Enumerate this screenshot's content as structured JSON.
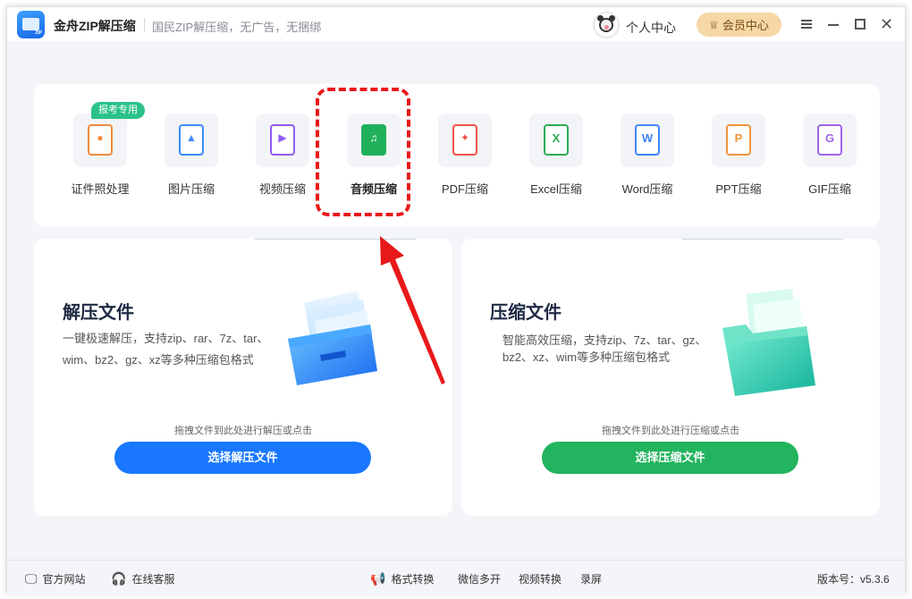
{
  "app": {
    "title": "金舟ZIP解压缩",
    "slogan": "国民ZIP解压缩，无广告，无捆绑",
    "logo_tag": "ZIP"
  },
  "header": {
    "personal_center": "个人中心",
    "vip_center": "会员中心"
  },
  "tools": [
    {
      "label": "证件照处理",
      "icon": "id-photo-icon",
      "color": "#f08a3c",
      "letter": "",
      "badge": "报考专用"
    },
    {
      "label": "图片压缩",
      "icon": "image-icon",
      "color": "#3d8af7",
      "letter": ""
    },
    {
      "label": "视频压缩",
      "icon": "video-icon",
      "color": "#8f5bf0",
      "letter": ""
    },
    {
      "label": "音频压缩",
      "icon": "audio-icon",
      "color": "#1fb05a",
      "letter": ""
    },
    {
      "label": "PDF压缩",
      "icon": "pdf-icon",
      "color": "#f0524a",
      "letter": ""
    },
    {
      "label": "Excel压缩",
      "icon": "excel-icon",
      "color": "#2aab58",
      "letter": "X"
    },
    {
      "label": "Word压缩",
      "icon": "word-icon",
      "color": "#3f86f5",
      "letter": "W"
    },
    {
      "label": "PPT压缩",
      "icon": "ppt-icon",
      "color": "#f0953a",
      "letter": "P"
    },
    {
      "label": "GIF压缩",
      "icon": "gif-icon",
      "color": "#a064e6",
      "letter": "G"
    }
  ],
  "decompress": {
    "title": "解压文件",
    "desc": "一键极速解压，支持zip、rar、7z、tar、wim、bz2、gz、xz等多种压缩包格式",
    "hint": "拖拽文件到此处进行解压或点击",
    "button": "选择解压文件",
    "color": "#1978ff"
  },
  "compress": {
    "title": "压缩文件",
    "desc": "智能高效压缩，支持zip、7z、tar、gz、bz2、xz、wim等多种压缩包格式",
    "hint": "拖拽文件到此处进行压缩或点击",
    "button": "选择压缩文件",
    "color": "#22b45e"
  },
  "footer": {
    "website": "官方网站",
    "support": "在线客服",
    "format_convert": "格式转换",
    "wechat_multi": "微信多开",
    "video_convert": "视频转换",
    "record": "录屏",
    "version": "版本号：v5.3.6"
  },
  "annotation_color": "#e8191a"
}
